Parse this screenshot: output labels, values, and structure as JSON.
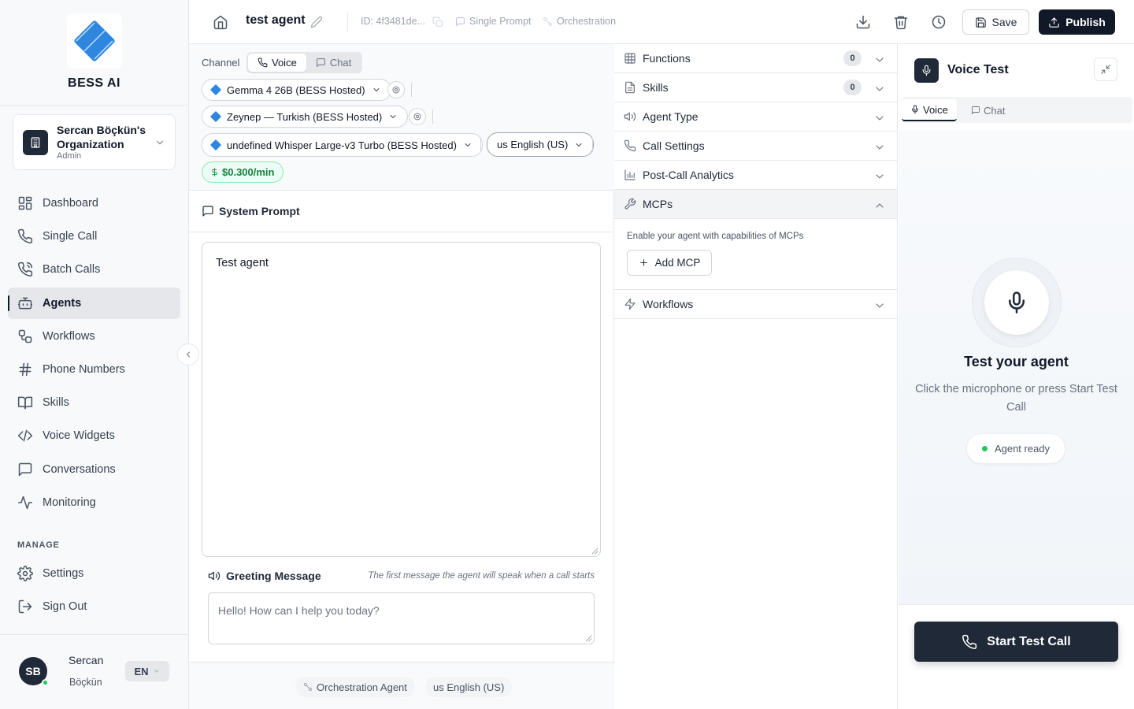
{
  "brand": {
    "name": "BESS AI"
  },
  "org": {
    "name": "Sercan Böçkün's Organization",
    "role": "Admin"
  },
  "nav": {
    "items": [
      {
        "label": "Dashboard",
        "icon": "dashboard-icon"
      },
      {
        "label": "Single Call",
        "icon": "phone-icon"
      },
      {
        "label": "Batch Calls",
        "icon": "phone-call-icon"
      },
      {
        "label": "Agents",
        "icon": "bot-icon",
        "active": true
      },
      {
        "label": "Workflows",
        "icon": "workflow-icon"
      },
      {
        "label": "Phone Numbers",
        "icon": "hash-icon"
      },
      {
        "label": "Skills",
        "icon": "book-icon"
      },
      {
        "label": "Voice Widgets",
        "icon": "code-icon"
      },
      {
        "label": "Conversations",
        "icon": "message-icon"
      },
      {
        "label": "Monitoring",
        "icon": "activity-icon"
      }
    ],
    "manage_label": "MANAGE",
    "manage_items": [
      {
        "label": "Settings",
        "icon": "gear-icon"
      },
      {
        "label": "Sign Out",
        "icon": "sign-out-icon"
      }
    ]
  },
  "user": {
    "initials": "SB",
    "first": "Sercan",
    "last": "Böçkün",
    "lang": "EN",
    "status_color": "#22c55e"
  },
  "topbar": {
    "agent_name": "test agent",
    "agent_id": "ID: 4f3481de...",
    "tag_prompt": "Single Prompt",
    "tag_orch": "Orchestration",
    "save_label": "Save",
    "publish_label": "Publish"
  },
  "editor": {
    "channel_label": "Channel",
    "channel_voice": "Voice",
    "channel_chat": "Chat",
    "llm_model": "Gemma 4 26B (BESS Hosted)",
    "tts_voice": "Zeynep — Turkish (BESS Hosted)",
    "stt_model": "undefined Whisper Large-v3 Turbo (BESS Hosted)",
    "language": "us English (US)",
    "price": "$0.300/min",
    "system_prompt_title": "System Prompt",
    "system_prompt_value": "Test agent",
    "greeting_title": "Greeting Message",
    "greeting_hint": "The first message the agent will speak when a call starts",
    "greeting_placeholder": "Hello! How can I help you today?",
    "footer_chip1": "Orchestration Agent",
    "footer_chip2": "us English (US)"
  },
  "accordion": {
    "functions": {
      "label": "Functions",
      "count": "0"
    },
    "skills": {
      "label": "Skills",
      "count": "0"
    },
    "agent_type": "Agent Type",
    "call_settings": "Call Settings",
    "post_call": "Post-Call Analytics",
    "mcps": "MCPs",
    "mcp_desc": "Enable your agent with capabilities of MCPs",
    "add_mcp": "Add MCP",
    "workflows": "Workflows"
  },
  "voice_test": {
    "title": "Voice Test",
    "tab_voice": "Voice",
    "tab_chat": "Chat",
    "heading": "Test your agent",
    "sub": "Click the microphone or press Start Test Call",
    "status": "Agent ready",
    "start_label": "Start Test Call"
  },
  "colors": {
    "accent": "#111827",
    "brand_blue": "#2e86de",
    "success": "#22c55e",
    "price_text": "#15803d"
  }
}
